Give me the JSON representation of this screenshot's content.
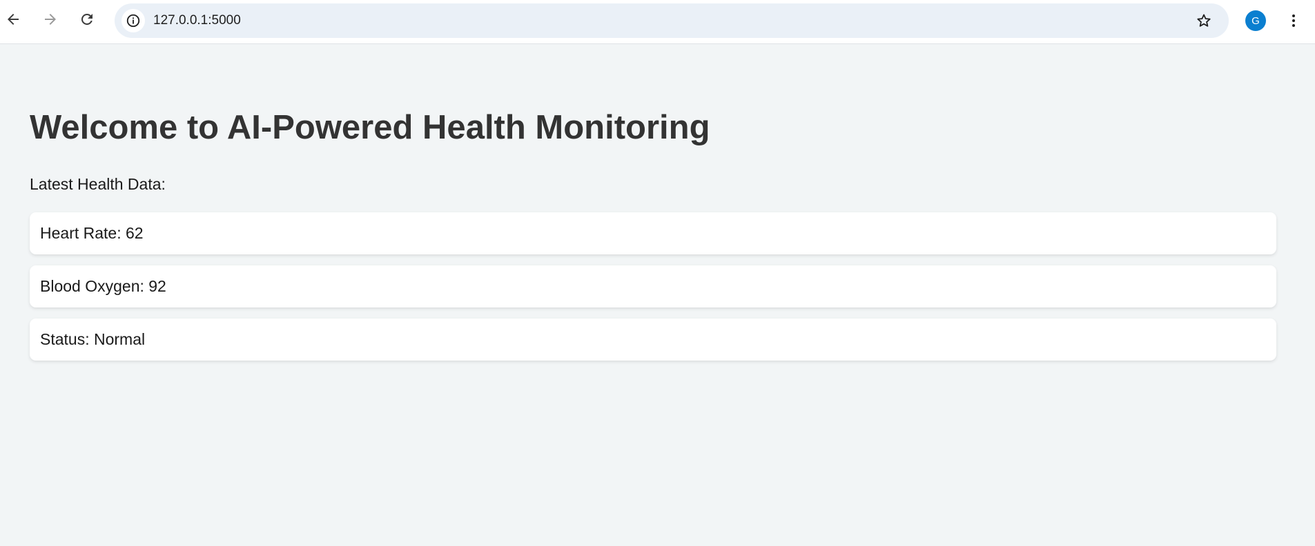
{
  "browser": {
    "url": "127.0.0.1:5000",
    "profile_initial": "G",
    "profile_color": "#0b7fd0",
    "icons": {
      "back": "arrow-left-icon",
      "forward": "arrow-right-icon",
      "reload": "reload-icon",
      "site_info": "info-icon",
      "bookmark": "star-icon",
      "menu": "kebab-menu-icon"
    }
  },
  "page": {
    "title": "Welcome to AI-Powered Health Monitoring",
    "subtitle": "Latest Health Data:",
    "metrics": [
      {
        "text": "Heart Rate: 62"
      },
      {
        "text": "Blood Oxygen: 92"
      },
      {
        "text": "Status: Normal"
      }
    ],
    "colors": {
      "background": "#f2f5f6",
      "card": "#ffffff",
      "title": "#333333"
    }
  }
}
